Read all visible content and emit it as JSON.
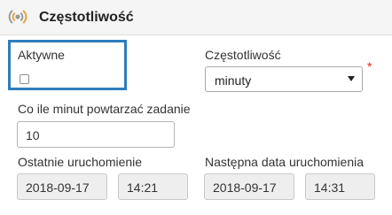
{
  "section": {
    "title": "Częstotliwość",
    "icon": "broadcast-icon"
  },
  "active": {
    "label": "Aktywne",
    "checked": false
  },
  "frequency": {
    "label": "Częstotliwość",
    "value": "minuty",
    "required_mark": "*"
  },
  "interval": {
    "label": "Co ile minut powtarzać zadanie",
    "value": "10"
  },
  "last_run": {
    "label": "Ostatnie uruchomienie",
    "date": "2018-09-17",
    "time": "14:21"
  },
  "next_run": {
    "label": "Następna data uruchomienia",
    "date": "2018-09-17",
    "time": "14:31"
  },
  "colors": {
    "accent_border": "#2e7dbc",
    "icon_orange": "#e8a33d",
    "icon_gray": "#9a9a9a",
    "required": "#e02020"
  }
}
